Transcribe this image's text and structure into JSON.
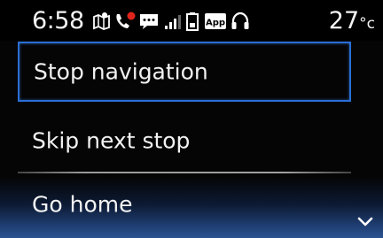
{
  "status_bar": {
    "time": "6:58",
    "temperature_value": "27",
    "temperature_unit": "°c",
    "icons": [
      "map-icon",
      "missed-call-icon",
      "message-icon",
      "signal-icon",
      "battery-icon",
      "app-icon",
      "headset-icon"
    ],
    "app_icon_text": "App",
    "accent_red": "#e0241b"
  },
  "menu": {
    "items": [
      {
        "label": "Stop navigation",
        "selected": true
      },
      {
        "label": "Skip next stop",
        "selected": false
      },
      {
        "label": "Go home",
        "selected": false
      }
    ],
    "selection_color": "#2a6fd6"
  },
  "scroll": {
    "indicator": "chevron-down-icon"
  }
}
